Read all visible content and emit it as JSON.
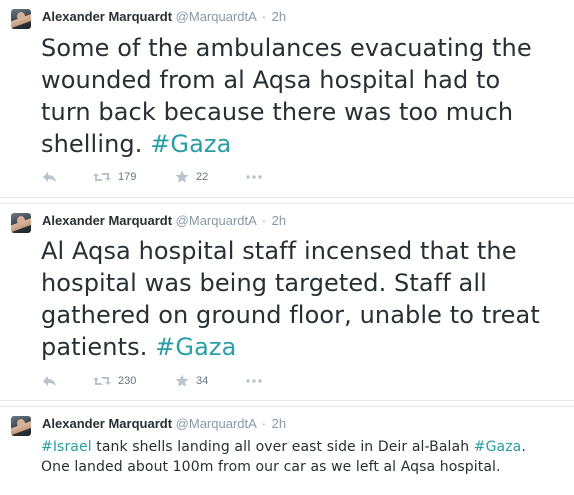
{
  "tweets": [
    {
      "author_name": "Alexander Marquardt",
      "handle": "@MarquardtA",
      "separator": "·",
      "time": "2h",
      "text_before": "Some of the ambulances evacuating the wounded from al Aqsa hospital had to turn back because there was too much shelling. ",
      "hashtag_end": "#Gaza",
      "retweets": "179",
      "favorites": "22"
    },
    {
      "author_name": "Alexander Marquardt",
      "handle": "@MarquardtA",
      "separator": "·",
      "time": "2h",
      "text_before": "Al Aqsa hospital staff incensed that the hospital was being targeted. Staff all gathered on ground floor, unable to treat patients. ",
      "hashtag_end": "#Gaza",
      "retweets": "230",
      "favorites": "34"
    },
    {
      "author_name": "Alexander Marquardt",
      "handle": "@MarquardtA",
      "separator": "·",
      "time": "2h",
      "hashtag_start": "#Israel",
      "text_middle": " tank shells landing all over east side in Deir al-Balah ",
      "hashtag_mid": "#Gaza",
      "text_after": ". One landed about 100m from our car as we left al Aqsa hospital."
    }
  ],
  "icons": {
    "reply": "reply-icon",
    "retweet": "retweet-icon",
    "favorite": "star-icon",
    "more": "more-icon"
  },
  "colors": {
    "hashtag": "#2a9ea5",
    "text": "#292f33",
    "meta": "#8899a6",
    "icon": "#a4b0b8"
  }
}
